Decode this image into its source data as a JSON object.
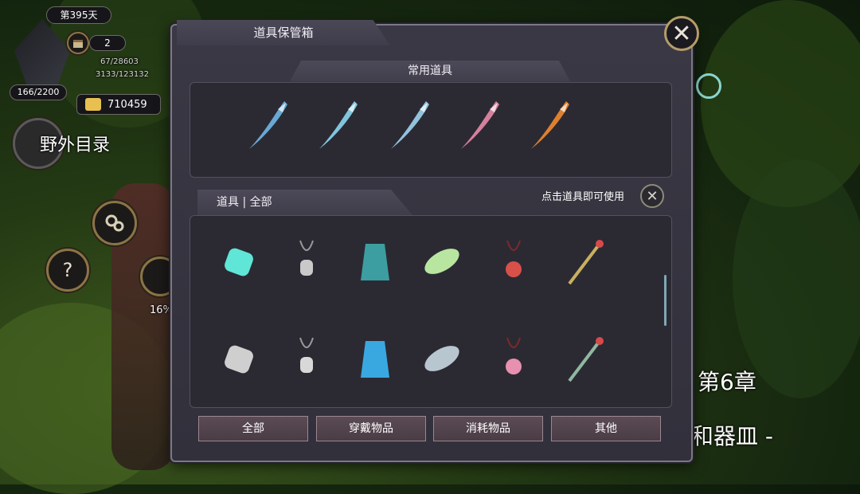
{
  "hud": {
    "day_label": "第395天",
    "calendar_count": "2",
    "stat_a": "67/28603",
    "stat_b": "3133/123132",
    "hp": "166/2200",
    "gold": "710459",
    "wild_menu": "野外目录",
    "progress": "16%",
    "help": "?"
  },
  "panel": {
    "title": "道具保管箱",
    "close": "✕",
    "favorites_title": "常用道具",
    "items_title": "道具 | 全部",
    "hint": "点击道具即可使用",
    "hint_close": "✕"
  },
  "favorites": [
    {
      "icon": "blue-feather-blade-icon",
      "color": "#6fb6e6"
    },
    {
      "icon": "ice-feather-blade-icon",
      "color": "#8ad6f0"
    },
    {
      "icon": "frost-blade-icon",
      "color": "#9fd3ee"
    },
    {
      "icon": "pink-feather-blade-icon",
      "color": "#e88aa8"
    },
    {
      "icon": "flame-blade-icon",
      "color": "#f08a30"
    }
  ],
  "items": [
    {
      "icon": "teal-gem-icon",
      "color": "#5fe6d6"
    },
    {
      "icon": "silver-amulet-icon",
      "color": "#c9c9c9"
    },
    {
      "icon": "teal-robe-icon",
      "color": "#3c9ea0"
    },
    {
      "icon": "green-leaf-icon",
      "color": "#b8e6a0"
    },
    {
      "icon": "red-pendant-icon",
      "color": "#d8504a"
    },
    {
      "icon": "flower-staff-icon",
      "color": "#c8b060"
    },
    {
      "icon": "winged-necklace-icon",
      "color": "#cfcfcf"
    },
    {
      "icon": "pearl-amulet-icon",
      "color": "#d8d8d8"
    },
    {
      "icon": "blue-crystal-icon",
      "color": "#3aa8e0"
    },
    {
      "icon": "silver-sword-icon",
      "color": "#b8c6d0"
    },
    {
      "icon": "pink-blade-icon",
      "color": "#e890b0"
    },
    {
      "icon": "stone-tablet-icon",
      "color": "#8fb8a0"
    }
  ],
  "tabs": [
    "全部",
    "穿戴物品",
    "消耗物品",
    "其他"
  ],
  "background": {
    "chapter": "第6章",
    "subtitle": "和器皿 -"
  }
}
